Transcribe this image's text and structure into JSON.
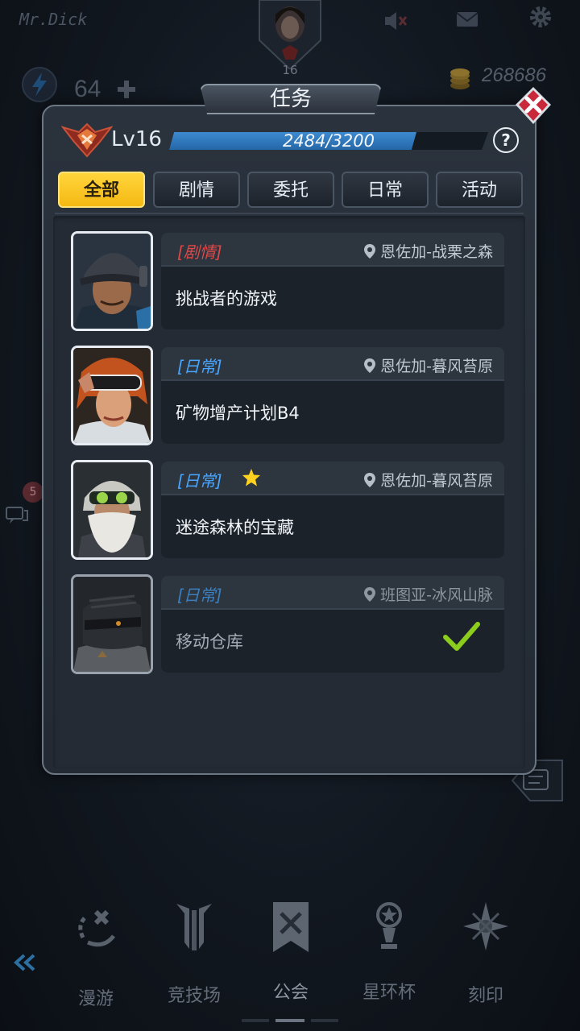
{
  "hud": {
    "player_name": "Mr.Dick",
    "avatar_level": "16",
    "energy": "64",
    "gold": "268686"
  },
  "chat": {
    "unread": "5"
  },
  "modal": {
    "title": "任务",
    "level_label": "Lv16",
    "xp_text": "2484/3200",
    "xp_fraction": 0.776,
    "help": "?",
    "tabs": [
      {
        "label": "全部",
        "active": true
      },
      {
        "label": "剧情",
        "active": false
      },
      {
        "label": "委托",
        "active": false
      },
      {
        "label": "日常",
        "active": false
      },
      {
        "label": "活动",
        "active": false
      }
    ],
    "quests": [
      {
        "type": "[剧情]",
        "type_color": "red",
        "location": "恩佐加-战栗之森",
        "name": "挑战者的游戏",
        "starred": false,
        "completed": false,
        "portrait": "helmet-man"
      },
      {
        "type": "[日常]",
        "type_color": "blue",
        "location": "恩佐加-暮风苔原",
        "name": "矿物增产计划B4",
        "starred": false,
        "completed": false,
        "portrait": "goggles-woman"
      },
      {
        "type": "[日常]",
        "type_color": "blue",
        "location": "恩佐加-暮风苔原",
        "name": "迷途森林的宝藏",
        "starred": true,
        "completed": false,
        "portrait": "bearded-old-man"
      },
      {
        "type": "[日常]",
        "type_color": "blue",
        "location": "班图亚-冰风山脉",
        "name": "移动仓库",
        "starred": false,
        "completed": true,
        "portrait": "masked-knight"
      }
    ]
  },
  "nav": {
    "items": [
      {
        "label": "漫游",
        "icon": "roam-icon"
      },
      {
        "label": "竞技场",
        "icon": "arena-icon"
      },
      {
        "label": "公会",
        "icon": "guild-banner-icon"
      },
      {
        "label": "星环杯",
        "icon": "star-cup-icon"
      },
      {
        "label": "刻印",
        "icon": "compass-star-icon"
      }
    ]
  },
  "colors": {
    "accent_yellow": "#f5b912",
    "xp_blue": "#2f7cc2",
    "story_red": "#e04848",
    "daily_blue": "#4aa6ff",
    "check_green": "#8ccc1c",
    "close_red": "#c8283a"
  }
}
